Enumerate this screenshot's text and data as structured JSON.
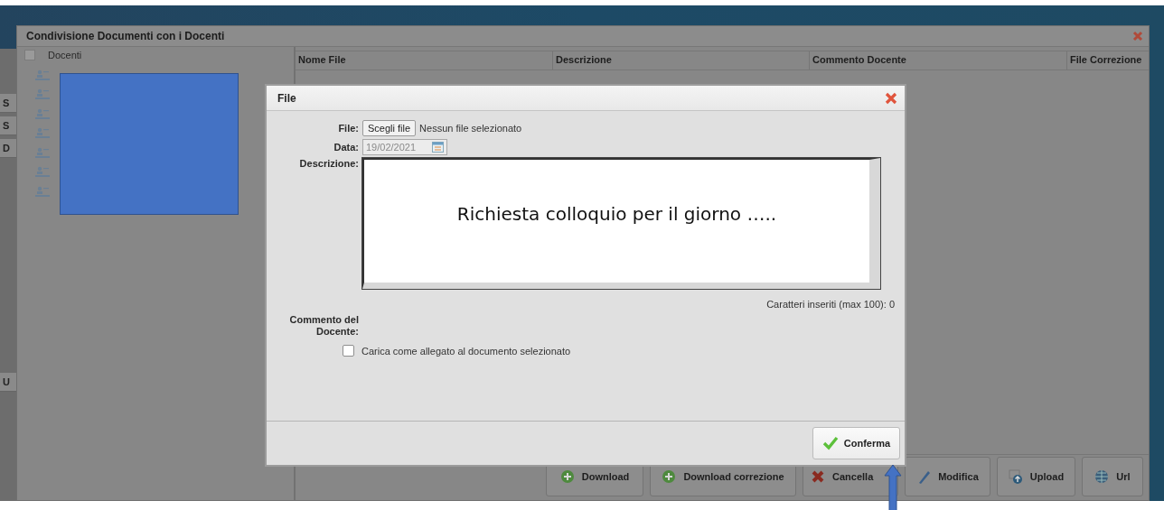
{
  "background_tabs": [
    "S",
    "S",
    "D",
    "U"
  ],
  "window": {
    "title": "Condivisione Documenti con i Docenti"
  },
  "teachers": {
    "heading": "Docenti",
    "select_all_checked": false,
    "rows": [
      {
        "kind": "teacher"
      },
      {
        "kind": "teacher"
      },
      {
        "kind": "teacher"
      },
      {
        "kind": "teacher"
      },
      {
        "kind": "teacher"
      },
      {
        "kind": "teacher"
      },
      {
        "kind": "teacher"
      }
    ]
  },
  "table": {
    "columns": [
      "Nome File",
      "Descrizione",
      "Commento Docente",
      "File Correzione"
    ]
  },
  "toolbar": [
    {
      "kind": "download",
      "label": "Download"
    },
    {
      "kind": "download",
      "label": "Download correzione"
    },
    {
      "kind": "delete",
      "label": "Cancella"
    },
    {
      "kind": "edit",
      "label": "Modifica"
    },
    {
      "kind": "upload",
      "label": "Upload"
    },
    {
      "kind": "url",
      "label": "Url"
    }
  ],
  "dialog": {
    "title": "File",
    "file_label": "File:",
    "file_button": "Scegli file",
    "file_status": "Nessun file selezionato",
    "date_label": "Data:",
    "date_value": "19/02/2021",
    "description_label": "Descrizione:",
    "description_value": "Richiesta colloquio per il giorno …..",
    "counter": "Caratteri inseriti (max 100): 0",
    "comment_label": "Commento del Docente:",
    "attach": {
      "label": "Carica come allegato al documento selezionato",
      "checked": false
    },
    "confirm_button": "Conferma"
  }
}
